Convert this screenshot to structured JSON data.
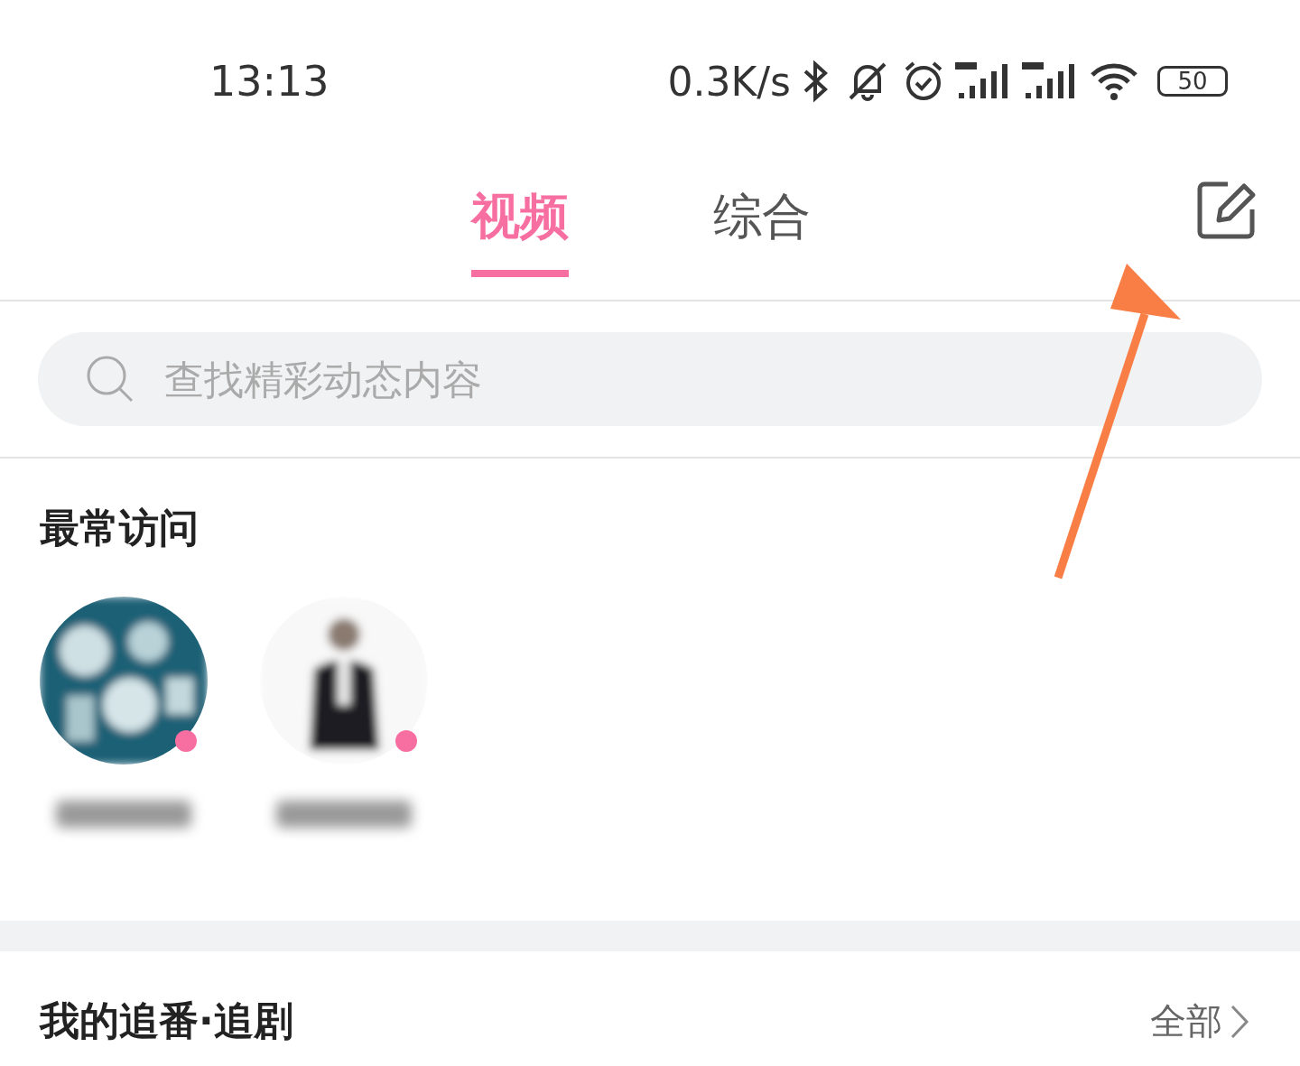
{
  "status_bar": {
    "time": "13:13",
    "net_speed": "0.3K/s",
    "battery": "50"
  },
  "tabs": [
    {
      "label": "视频",
      "selected": true
    },
    {
      "label": "综合",
      "selected": false
    }
  ],
  "search": {
    "placeholder": "查找精彩动态内容"
  },
  "frequent": {
    "title": "最常访问",
    "items": [
      {
        "kind": "pattern",
        "has_update": true
      },
      {
        "kind": "figure",
        "has_update": true
      }
    ]
  },
  "following": {
    "title": "我的追番·追剧",
    "link": "全部"
  }
}
